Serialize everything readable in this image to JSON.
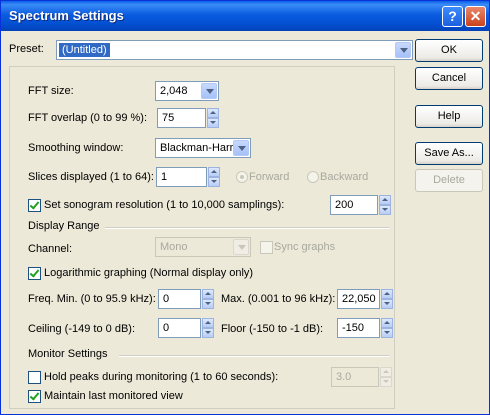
{
  "window": {
    "title": "Spectrum Settings"
  },
  "preset": {
    "label": "Preset:",
    "value": "(Untitled)"
  },
  "buttons": {
    "ok": "OK",
    "cancel": "Cancel",
    "help": "Help",
    "save_as": "Save As...",
    "delete": "Delete"
  },
  "fft_size": {
    "label": "FFT size:",
    "value": "2,048"
  },
  "fft_overlap": {
    "label": "FFT overlap (0 to 99 %):",
    "value": "75"
  },
  "smoothing": {
    "label": "Smoothing window:",
    "value": "Blackman-Harris"
  },
  "slices": {
    "label": "Slices displayed (1 to 64):",
    "value": "1",
    "forward": "Forward",
    "backward": "Backward"
  },
  "sonogram": {
    "label": "Set sonogram resolution (1 to 10,000 samplings):",
    "value": "200",
    "checked": true
  },
  "display_range": {
    "heading": "Display Range",
    "channel_label": "Channel:",
    "channel_value": "Mono",
    "sync_graphs": "Sync graphs",
    "log_graphing": "Logarithmic graphing (Normal display only)",
    "freq_min_label": "Freq. Min. (0 to 95.9 kHz):",
    "freq_min_value": "0",
    "max_label": "Max. (0.001 to 96 kHz):",
    "max_value": "22,050",
    "ceiling_label": "Ceiling (-149 to 0 dB):",
    "ceiling_value": "0",
    "floor_label": "Floor (-150 to -1 dB):",
    "floor_value": "-150"
  },
  "monitor": {
    "heading": "Monitor Settings",
    "hold_peaks": "Hold peaks during monitoring (1 to 60 seconds):",
    "hold_value": "3.0",
    "maintain": "Maintain last monitored view"
  }
}
